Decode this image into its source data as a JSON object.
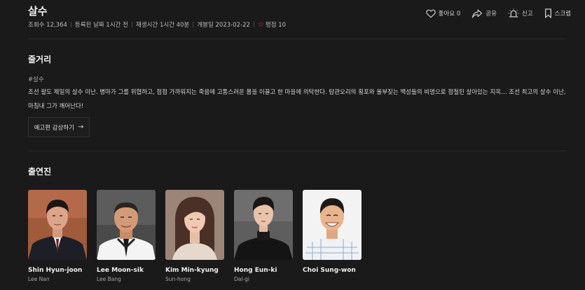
{
  "header": {
    "title": "살수",
    "meta": {
      "views": "조회수 12,364",
      "registered": "등록된 날짜 1시간 전",
      "runtime": "재생시간 1시간 40분",
      "release": "개봉일 2023-02-22",
      "rating": "평점 10"
    },
    "actions": [
      {
        "label": "좋아요 0",
        "icon": "heart-icon"
      },
      {
        "label": "공유",
        "icon": "share-icon"
      },
      {
        "label": "신고",
        "icon": "siren-icon"
      },
      {
        "label": "스크랩",
        "icon": "bookmark-icon"
      }
    ]
  },
  "plot": {
    "section_title": "줄거리",
    "tag": "#살수",
    "synopsis": "조선 팔도 제일의 살수 이난. 병마가 그를 위협하고, 점점 가까워지는 죽음에 고통스러운 몸을 이끌고 한 마을에 의탁한다. 탐관오리의 횡포와 울부짖는 백성들의 비명으로 점철된 살아있는 지옥… 조선 최고의 살수 이난, 마침내 그가 깨어난다!",
    "trailer_button": "예고편 감상하기",
    "trailer_arrow": "→"
  },
  "cast": {
    "section_title": "출연진",
    "members": [
      {
        "name": "Shin Hyun-joon",
        "role": "Lee Nan"
      },
      {
        "name": "Lee Moon-sik",
        "role": "Lee Bang"
      },
      {
        "name": "Kim Min-kyung",
        "role": "Sun-hong"
      },
      {
        "name": "Hong Eun-ki",
        "role": "Dal-gi"
      },
      {
        "name": "Choi Sung-won",
        "role": ""
      }
    ]
  },
  "colors": {
    "background": "#1a1a1a",
    "rating_star": "#e0344a",
    "divider": "#2c2c2c"
  }
}
